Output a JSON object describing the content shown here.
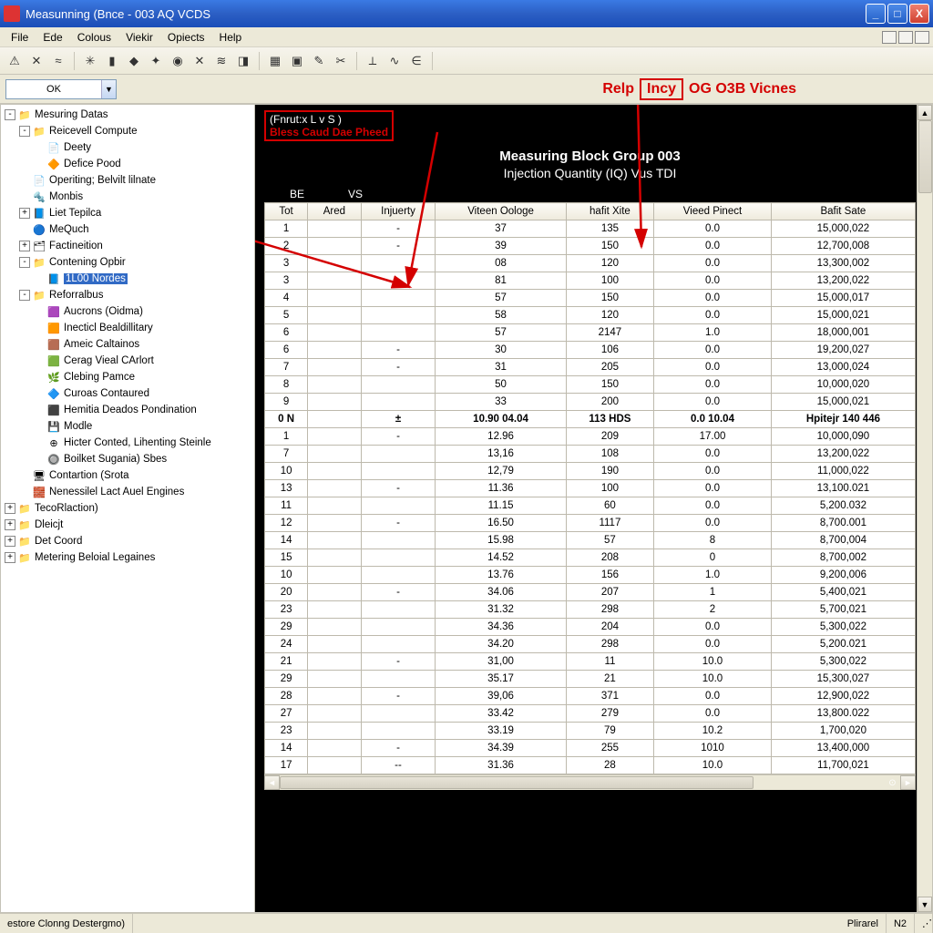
{
  "window": {
    "title": "Measunning (Bnce - 003 AQ VCDS"
  },
  "menu": [
    "File",
    "Ede",
    "Colous",
    "Viekir",
    "Opiects",
    "Help"
  ],
  "combo": {
    "value": "OK"
  },
  "annotation": {
    "left_word": "Relp",
    "mid_box": "Incy",
    "right": "OG O3B Vicnes"
  },
  "tree": [
    {
      "lvl": 0,
      "tw": "-",
      "ic": "📁",
      "lbl": "Mesuring Datas"
    },
    {
      "lvl": 1,
      "tw": "-",
      "ic": "📁",
      "lbl": "Reicevell Compute"
    },
    {
      "lvl": 2,
      "tw": "",
      "ic": "📄",
      "lbl": "Deety"
    },
    {
      "lvl": 2,
      "tw": "",
      "ic": "🔶",
      "lbl": "Defice Pood"
    },
    {
      "lvl": 1,
      "tw": "",
      "ic": "📄",
      "lbl": "Operiting; Belvilt lilnate"
    },
    {
      "lvl": 1,
      "tw": "",
      "ic": "🔩",
      "lbl": "Monbis"
    },
    {
      "lvl": 1,
      "tw": "+",
      "ic": "📘",
      "lbl": "Liet Tepilca"
    },
    {
      "lvl": 1,
      "tw": "",
      "ic": "🔵",
      "lbl": "MeQuch"
    },
    {
      "lvl": 1,
      "tw": "+",
      "ic": "🗂",
      "lbl": "Factineition"
    },
    {
      "lvl": 1,
      "tw": "-",
      "ic": "📁",
      "lbl": "Contening Opbir"
    },
    {
      "lvl": 2,
      "tw": "",
      "ic": "📘",
      "lbl": "1L00 Nordes",
      "sel": true
    },
    {
      "lvl": 1,
      "tw": "-",
      "ic": "📁",
      "lbl": "Reforralbus"
    },
    {
      "lvl": 2,
      "tw": "",
      "ic": "🟪",
      "lbl": "Aucrons (Oidma)"
    },
    {
      "lvl": 2,
      "tw": "",
      "ic": "🟧",
      "lbl": "Inecticl Bealdillitary"
    },
    {
      "lvl": 2,
      "tw": "",
      "ic": "🟫",
      "lbl": "Ameic Caltainos"
    },
    {
      "lvl": 2,
      "tw": "",
      "ic": "🟩",
      "lbl": "Cerag Vieal CArlort"
    },
    {
      "lvl": 2,
      "tw": "",
      "ic": "🌿",
      "lbl": "Clebing Pamce"
    },
    {
      "lvl": 2,
      "tw": "",
      "ic": "🔷",
      "lbl": "Curoas Contaured"
    },
    {
      "lvl": 2,
      "tw": "",
      "ic": "⬛",
      "lbl": "Hemitia Deados Pondination"
    },
    {
      "lvl": 2,
      "tw": "",
      "ic": "💾",
      "lbl": "Modle"
    },
    {
      "lvl": 2,
      "tw": "",
      "ic": "⊕",
      "lbl": "Hicter Conted, Lihenting Steinle"
    },
    {
      "lvl": 2,
      "tw": "",
      "ic": "🔘",
      "lbl": "Boilket Sugania) Sbes"
    },
    {
      "lvl": 1,
      "tw": "",
      "ic": "🖥",
      "lbl": "Contartion (Srota"
    },
    {
      "lvl": 1,
      "tw": "",
      "ic": "🧱",
      "lbl": "Nenessilel Lact Auel Engines"
    },
    {
      "lvl": 0,
      "tw": "+",
      "ic": "📁",
      "lbl": "TecoRlaction)"
    },
    {
      "lvl": 0,
      "tw": "+",
      "ic": "📁",
      "lbl": "Dleicjt"
    },
    {
      "lvl": 0,
      "tw": "+",
      "ic": "📁",
      "lbl": "Det Coord"
    },
    {
      "lvl": 0,
      "tw": "+",
      "ic": "📁",
      "lbl": "Metering Beloial Legaines"
    }
  ],
  "header_tab": {
    "white": "(Fnrut:x L v S )",
    "red": "Bless Caud Dae Pheed"
  },
  "block": {
    "title": "Measuring Block Group 003",
    "subtitle": "Injection Quantity (IQ) Vus TDI"
  },
  "axis": {
    "a": "BE",
    "b": "VS"
  },
  "columns": [
    "Tot",
    "Ared",
    "Injuerty",
    "Viteen Oologe",
    "hafit Xite",
    "Vieed Pinect",
    "Bafit Sate"
  ],
  "rows": [
    [
      "1",
      "",
      "-",
      "37",
      "135",
      "0.0",
      "15,000,022"
    ],
    [
      "2",
      "",
      "-",
      "39",
      "150",
      "0.0",
      "12,700,008"
    ],
    [
      "3",
      "",
      "",
      "08",
      "120",
      "0.0",
      "13,300,002"
    ],
    [
      "3",
      "",
      "-",
      "81",
      "100",
      "0.0",
      "13,200,022"
    ],
    [
      "4",
      "",
      "",
      "57",
      "150",
      "0.0",
      "15,000,017"
    ],
    [
      "5",
      "",
      "",
      "58",
      "120",
      "0.0",
      "15,000,021"
    ],
    [
      "6",
      "",
      "",
      "57",
      "2147",
      "1.0",
      "18,000,001"
    ],
    [
      "6",
      "",
      "-",
      "30",
      "106",
      "0.0",
      "19,200,027"
    ],
    [
      "7",
      "",
      "-",
      "31",
      "205",
      "0.0",
      "13,000,024"
    ],
    [
      "8",
      "",
      "",
      "50",
      "150",
      "0.0",
      "10,000,020"
    ],
    [
      "9",
      "",
      "",
      "33",
      "200",
      "0.0",
      "15,000,021"
    ]
  ],
  "summary": [
    "0 N",
    "",
    "±",
    "10.90 04.04",
    "113 HDS",
    "0.0 10.04",
    "Hpitejr 140 446"
  ],
  "rows2": [
    [
      "1",
      "",
      "-",
      "12.96",
      "209",
      "17.00",
      "10,000,090"
    ],
    [
      "7",
      "",
      "",
      "13,16",
      "108",
      "0.0",
      "13,200,022"
    ],
    [
      "10",
      "",
      "",
      "12,79",
      "190",
      "0.0",
      "11,000,022"
    ],
    [
      "13",
      "",
      "-",
      "11.36",
      "100",
      "0.0",
      "13,100.021"
    ],
    [
      "11",
      "",
      "",
      "11.15",
      "60",
      "0.0",
      "5,200.032"
    ],
    [
      "12",
      "",
      "-",
      "16.50",
      "1117",
      "0.0",
      "8,700.001"
    ],
    [
      "14",
      "",
      "",
      "15.98",
      "57",
      "8",
      "8,700,004"
    ],
    [
      "15",
      "",
      "",
      "14.52",
      "208",
      "0",
      "8,700,002"
    ],
    [
      "10",
      "",
      "",
      "13.76",
      "156",
      "1.0",
      "9,200,006"
    ],
    [
      "20",
      "",
      "-",
      "34.06",
      "207",
      "1",
      "5,400,021"
    ],
    [
      "23",
      "",
      "",
      "31.32",
      "298",
      "2",
      "5,700,021"
    ],
    [
      "29",
      "",
      "",
      "34.36",
      "204",
      "0.0",
      "5,300,022"
    ],
    [
      "24",
      "",
      "",
      "34.20",
      "298",
      "0.0",
      "5,200.021"
    ],
    [
      "21",
      "",
      "-",
      "31,00",
      "11",
      "10.0",
      "5,300,022"
    ],
    [
      "29",
      "",
      "",
      "35.17",
      "21",
      "10.0",
      "15,300,027"
    ],
    [
      "28",
      "",
      "-",
      "39,06",
      "371",
      "0.0",
      "12,900,022"
    ],
    [
      "27",
      "",
      "",
      "33.42",
      "279",
      "0.0",
      "13,800.022"
    ],
    [
      "23",
      "",
      "",
      "33.19",
      "79",
      "10.2",
      "1,700,020"
    ],
    [
      "14",
      "",
      "-",
      "34.39",
      "255",
      "1010",
      "13,400,000"
    ],
    [
      "17",
      "",
      "--",
      "31.36",
      "28",
      "10.0",
      "11,700,021"
    ]
  ],
  "status": {
    "left": "estore Clonng Destergmo)",
    "right1": "Plirarel",
    "right2": "N2"
  }
}
